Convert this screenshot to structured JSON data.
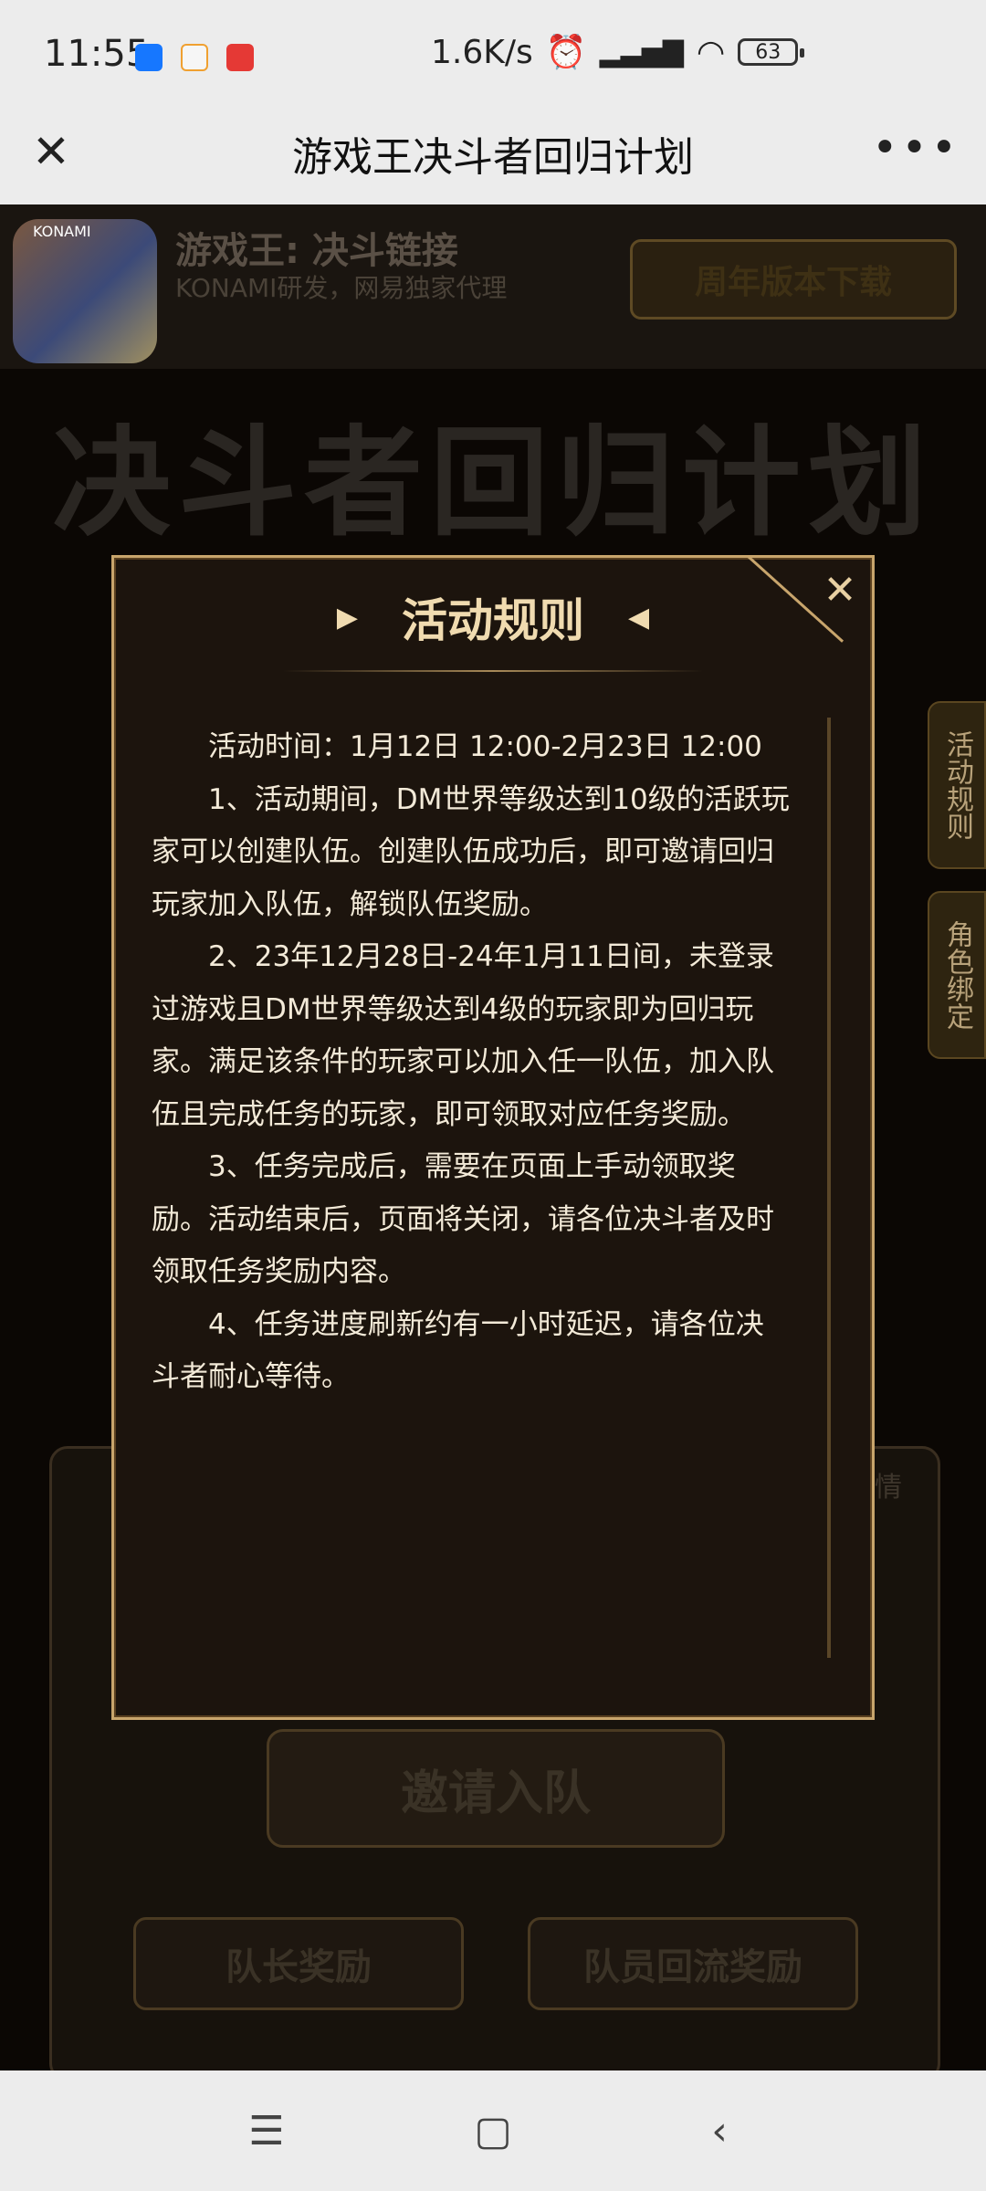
{
  "status_bar": {
    "time": "11:55",
    "net_speed": "1.6K/s",
    "battery": "63",
    "apps": [
      {
        "icon": "alipay-icon",
        "color": "#1677ff"
      },
      {
        "icon": "chat-app-icon",
        "color": "#f0a030"
      },
      {
        "icon": "red-app-icon",
        "color": "#e53935"
      }
    ]
  },
  "title_bar": {
    "title": "游戏王决斗者回归计划"
  },
  "app_banner": {
    "icon_label": "KONAMI",
    "name": "游戏王: 决斗链接",
    "subtitle": "KONAMI研发，网易独家代理",
    "download_label": "周年版本下载"
  },
  "page": {
    "big_title": "决斗者回归计划",
    "side_tabs": [
      "活动规则",
      "角色绑定"
    ],
    "details_link": "情",
    "invite_label": "邀请入队",
    "reward_tabs": [
      "队长奖励",
      "队员回流奖励"
    ]
  },
  "modal": {
    "title": "活动规则",
    "paragraphs": [
      "活动时间：1月12日 12:00-2月23日 12:00",
      "1、活动期间，DM世界等级达到10级的活跃玩家可以创建队伍。创建队伍成功后，即可邀请回归玩家加入队伍，解锁队伍奖励。",
      "2、23年12月28日-24年1月11日间，未登录过游戏且DM世界等级达到4级的玩家即为回归玩家。满足该条件的玩家可以加入任一队伍，加入队伍且完成任务的玩家，即可领取对应任务奖励。",
      "3、任务完成后，需要在页面上手动领取奖励。活动结束后，页面将关闭，请各位决斗者及时领取任务奖励内容。",
      "4、任务进度刷新约有一小时延迟，请各位决斗者耐心等待。"
    ]
  }
}
